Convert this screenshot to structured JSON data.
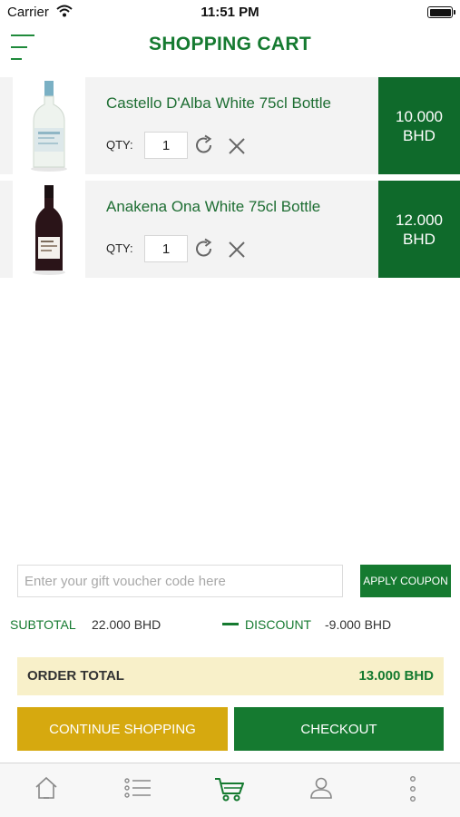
{
  "status_bar": {
    "carrier": "Carrier",
    "time": "11:51 PM"
  },
  "header": {
    "title": "SHOPPING CART",
    "menu_icon": "hamburger-menu-icon"
  },
  "cart": {
    "qty_label": "QTY:",
    "items": [
      {
        "name": "Castello D'Alba White 75cl Bottle",
        "qty": "1",
        "price_amount": "10.000",
        "price_currency": "BHD",
        "image": "white-wine-bottle"
      },
      {
        "name": "Anakena Ona White 75cl Bottle",
        "qty": "1",
        "price_amount": "12.000",
        "price_currency": "BHD",
        "image": "dark-wine-bottle"
      }
    ]
  },
  "coupon": {
    "placeholder": "Enter your gift voucher code here",
    "value": "",
    "apply_label": "APPLY COUPON"
  },
  "totals": {
    "subtotal_label": "SUBTOTAL",
    "subtotal_value": "22.000 BHD",
    "discount_label": "DISCOUNT",
    "discount_value": "-9.000 BHD",
    "order_total_label": "ORDER TOTAL",
    "order_total_value": "13.000 BHD"
  },
  "actions": {
    "continue_label": "CONTINUE SHOPPING",
    "checkout_label": "CHECKOUT"
  },
  "tab_bar": {
    "tabs": [
      "home-icon",
      "list-icon",
      "cart-icon",
      "user-icon",
      "more-icon"
    ],
    "active": "cart-icon"
  },
  "colors": {
    "brand_green": "#157a30",
    "price_green": "#0f6a2b",
    "continue_gold": "#d6a90f",
    "order_total_bg": "#f8f0c9"
  }
}
